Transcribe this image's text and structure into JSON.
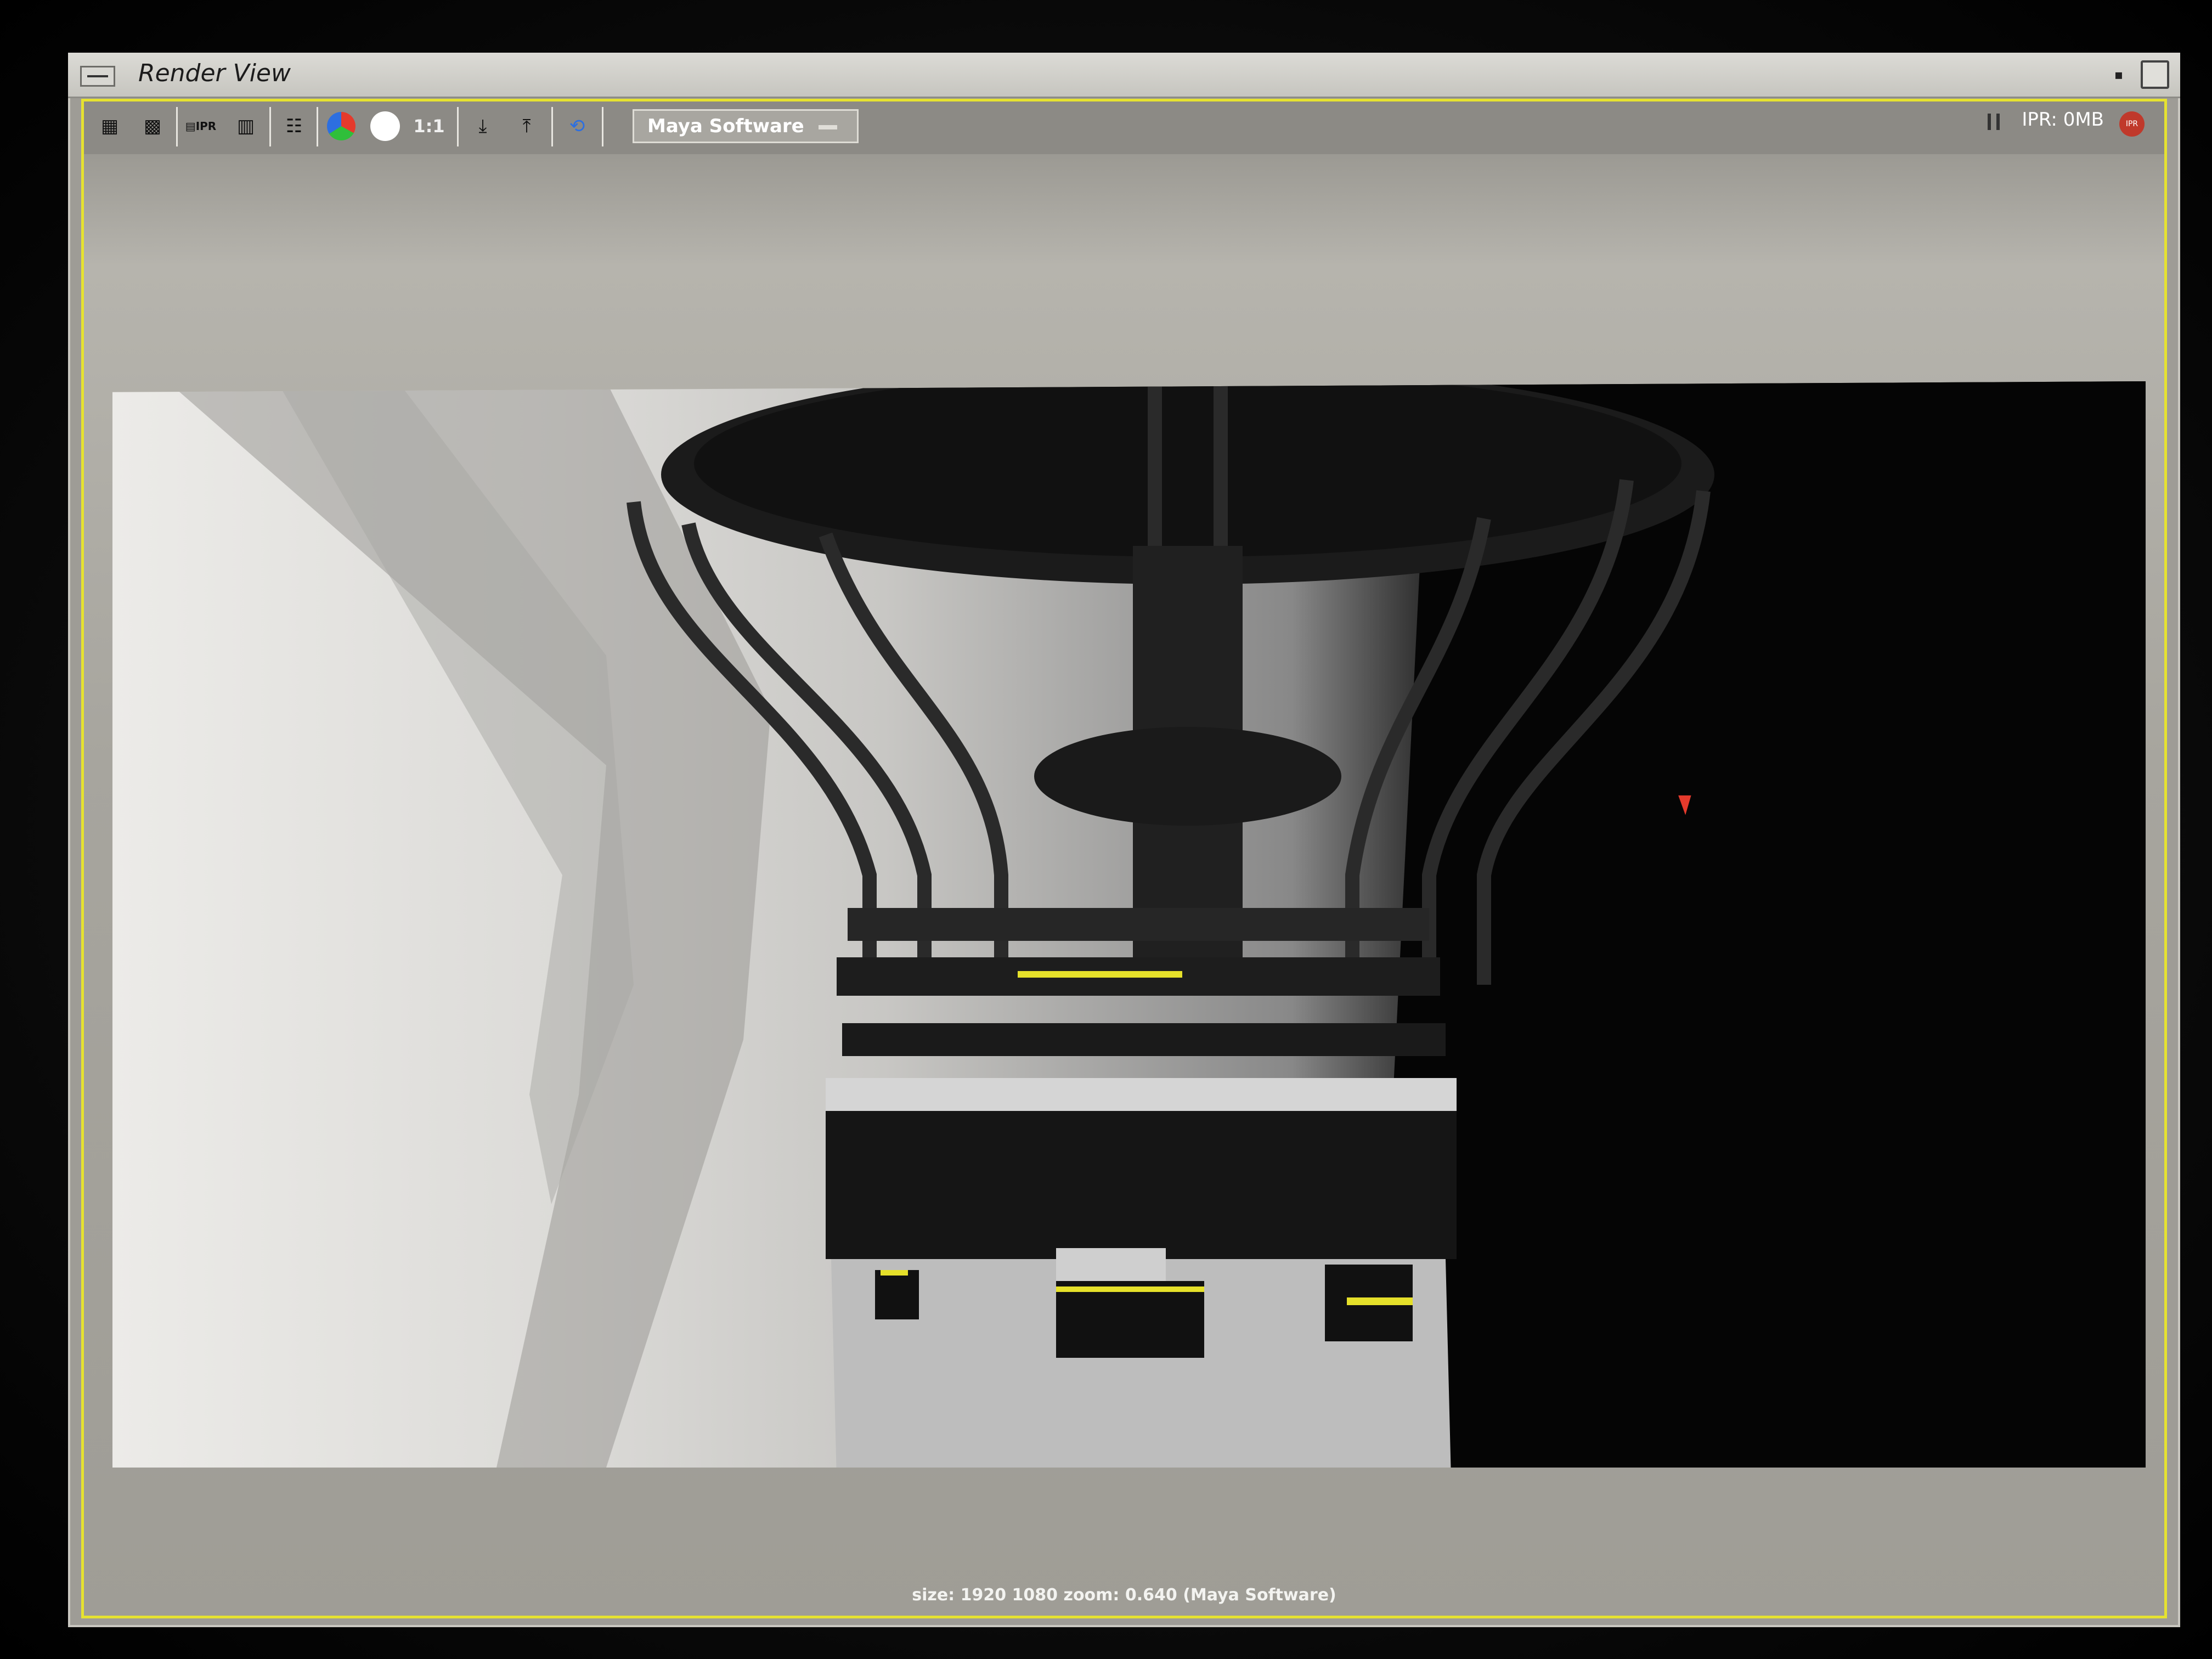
{
  "window": {
    "title": "Render View"
  },
  "toolbar": {
    "buttons": [
      {
        "name": "redo-previous-render-icon",
        "glyph": "🎬"
      },
      {
        "name": "render-region-icon",
        "glyph": "▦"
      },
      {
        "name": "ipr-render-icon",
        "glyph": "IPR"
      },
      {
        "name": "refresh-ipr-icon",
        "glyph": "▤"
      },
      {
        "name": "render-settings-icon",
        "glyph": "☷"
      },
      {
        "name": "color-channels-icon",
        "glyph": "●"
      },
      {
        "name": "alpha-channel-icon",
        "glyph": "○"
      },
      {
        "name": "real-size-icon",
        "glyph": "1:1"
      },
      {
        "name": "keep-image-icon",
        "glyph": "⤓"
      },
      {
        "name": "remove-image-icon",
        "glyph": "⤒"
      },
      {
        "name": "snapshot-icon",
        "glyph": "⟲"
      }
    ],
    "renderer": "Maya Software",
    "ipr_label": "IPR: 0MB"
  },
  "status": {
    "text": "size: 1920 1080 zoom: 0.640  (Maya Software)"
  },
  "colors": {
    "frame_border": "#e6e230",
    "ipr_badge": "#c0392b"
  }
}
